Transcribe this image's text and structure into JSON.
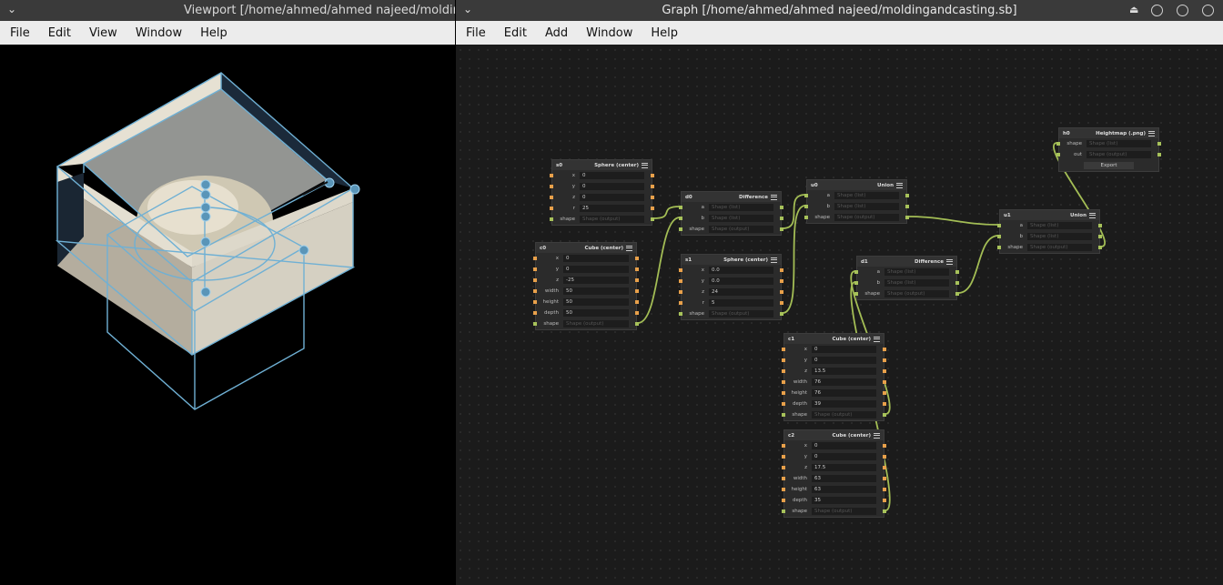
{
  "viewport": {
    "title": "Viewport [/home/ahmed/ahmed najeed/moldingandcasting.sb]",
    "menu": [
      "File",
      "Edit",
      "View",
      "Window",
      "Help"
    ]
  },
  "graph": {
    "title": "Graph [/home/ahmed/ahmed najeed/moldingandcasting.sb]",
    "menu": [
      "File",
      "Edit",
      "Add",
      "Window",
      "Help"
    ],
    "nodes": {
      "s0": {
        "id": "s0",
        "type": "Sphere (center)",
        "rows": [
          [
            "x",
            "0"
          ],
          [
            "y",
            "0"
          ],
          [
            "z",
            "0"
          ],
          [
            "r",
            "25"
          ],
          [
            "shape",
            "Shape (output)"
          ]
        ]
      },
      "c0": {
        "id": "c0",
        "type": "Cube (center)",
        "rows": [
          [
            "x",
            "0"
          ],
          [
            "y",
            "0"
          ],
          [
            "z",
            "-25"
          ],
          [
            "width",
            "50"
          ],
          [
            "height",
            "50"
          ],
          [
            "depth",
            "50"
          ],
          [
            "shape",
            "Shape (output)"
          ]
        ]
      },
      "d0": {
        "id": "d0",
        "type": "Difference",
        "rows": [
          [
            "a",
            "Shape (list)"
          ],
          [
            "b",
            "Shape (list)"
          ],
          [
            "shape",
            "Shape (output)"
          ]
        ]
      },
      "s1": {
        "id": "s1",
        "type": "Sphere (center)",
        "rows": [
          [
            "x",
            "0.0"
          ],
          [
            "y",
            "0.0"
          ],
          [
            "z",
            "24"
          ],
          [
            "r",
            "5"
          ],
          [
            "shape",
            "Shape (output)"
          ]
        ]
      },
      "u0": {
        "id": "u0",
        "type": "Union",
        "rows": [
          [
            "a",
            "Shape (list)"
          ],
          [
            "b",
            "Shape (list)"
          ],
          [
            "shape",
            "Shape (output)"
          ]
        ]
      },
      "d1": {
        "id": "d1",
        "type": "Difference",
        "rows": [
          [
            "a",
            "Shape (list)"
          ],
          [
            "b",
            "Shape (list)"
          ],
          [
            "shape",
            "Shape (output)"
          ]
        ]
      },
      "u1": {
        "id": "u1",
        "type": "Union",
        "rows": [
          [
            "a",
            "Shape (list)"
          ],
          [
            "b",
            "Shape (list)"
          ],
          [
            "shape",
            "Shape (output)"
          ]
        ]
      },
      "h0": {
        "id": "h0",
        "type": "Heightmap (.png)",
        "rows": [
          [
            "shape",
            "Shape (list)"
          ],
          [
            "out",
            "Shape (output)"
          ]
        ],
        "button": "Export"
      },
      "c1": {
        "id": "c1",
        "type": "Cube (center)",
        "rows": [
          [
            "x",
            "0"
          ],
          [
            "y",
            "0"
          ],
          [
            "z",
            "13.5"
          ],
          [
            "width",
            "76"
          ],
          [
            "height",
            "76"
          ],
          [
            "depth",
            "39"
          ],
          [
            "shape",
            "Shape (output)"
          ]
        ]
      },
      "c2": {
        "id": "c2",
        "type": "Cube (center)",
        "rows": [
          [
            "x",
            "0"
          ],
          [
            "y",
            "0"
          ],
          [
            "z",
            "17.5"
          ],
          [
            "width",
            "63"
          ],
          [
            "height",
            "63"
          ],
          [
            "depth",
            "35"
          ],
          [
            "shape",
            "Shape (output)"
          ]
        ]
      }
    }
  },
  "colors": {
    "wire": "#a3bd55",
    "input_pin": "#e8a04a",
    "output_pin": "#a7c25a",
    "wireframe": "#6fb0d4"
  }
}
